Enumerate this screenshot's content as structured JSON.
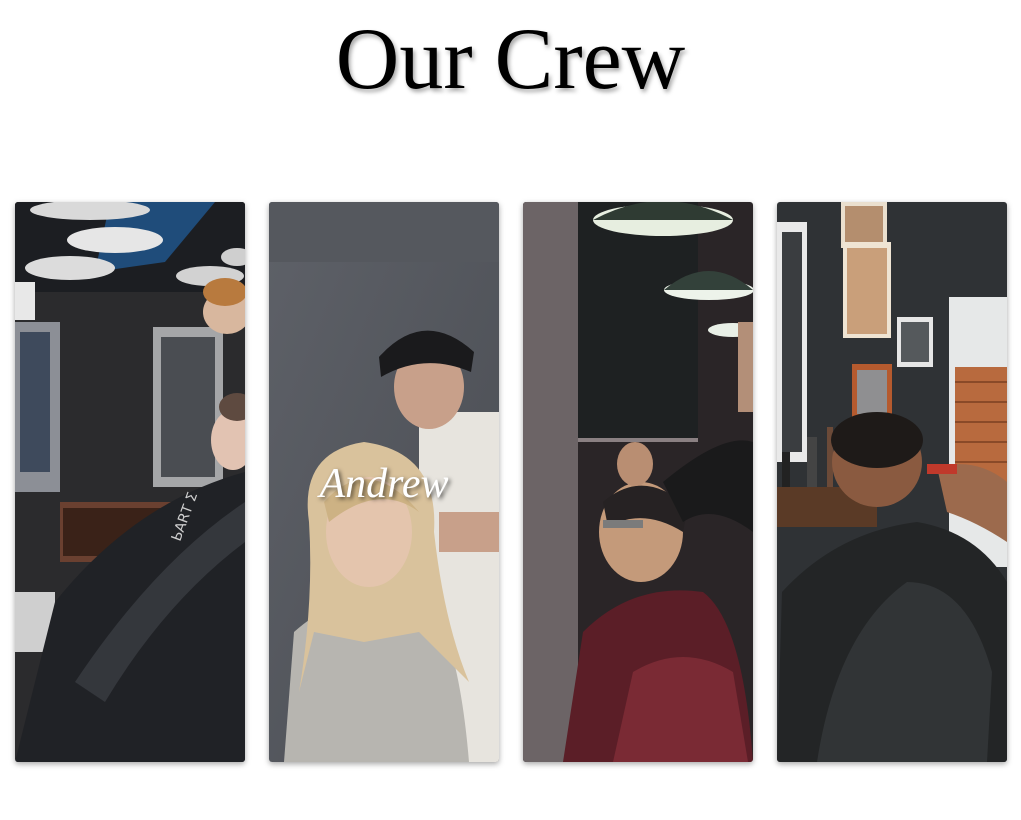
{
  "page": {
    "title": "Our Crew"
  },
  "crew": [
    {
      "name": "",
      "photo": "barber-salon-woman-in-black-cape-photo"
    },
    {
      "name": "Andrew",
      "photo": "stylist-in-beanie-with-blonde-client-photo"
    },
    {
      "name": "",
      "photo": "barber-trimming-client-under-lamps-photo"
    },
    {
      "name": "",
      "photo": "barber-fading-client-haircut-photo"
    }
  ],
  "colors": {
    "background": "#ffffff",
    "title": "#000000",
    "name_text": "#ffffff"
  }
}
